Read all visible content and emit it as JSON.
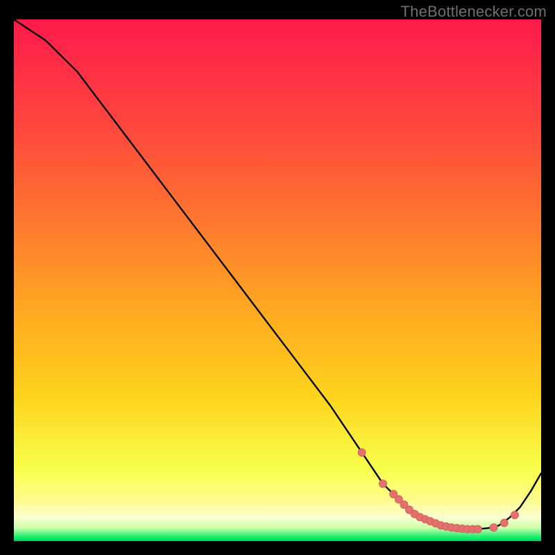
{
  "watermark": "TheBottleneсker.com",
  "colors": {
    "gradient_top": "#ff1a4b",
    "gradient_upper_mid": "#ff7b2e",
    "gradient_mid": "#ffd21c",
    "gradient_lower": "#fffb8a",
    "gradient_pale": "#fbffd2",
    "gradient_bottom": "#00e968",
    "background": "#000000",
    "curve": "#000000",
    "marker_fill": "#e2726e",
    "marker_stroke": "#d85f5b"
  },
  "chart_data": {
    "type": "line",
    "title": "",
    "xlabel": "",
    "ylabel": "",
    "xlim": [
      0,
      100
    ],
    "ylim": [
      0,
      100
    ],
    "series": [
      {
        "name": "bottleneck-curve",
        "x": [
          0,
          6,
          12,
          18,
          24,
          30,
          36,
          42,
          48,
          54,
          60,
          64,
          68,
          70,
          72,
          74,
          76,
          78,
          80,
          82,
          84,
          86,
          88,
          90,
          92,
          94,
          96,
          98,
          100
        ],
        "y": [
          100,
          96,
          90,
          82,
          74,
          66,
          58,
          50,
          42,
          34,
          26,
          20,
          14,
          11,
          9,
          7,
          5.2,
          4.2,
          3.4,
          2.8,
          2.5,
          2.3,
          2.3,
          2.5,
          3.0,
          4.5,
          6.5,
          9.5,
          13
        ]
      }
    ],
    "markers": {
      "name": "valley-markers",
      "x": [
        66,
        70,
        72,
        73,
        74,
        75,
        76,
        77,
        78,
        79,
        80,
        81,
        82,
        83,
        84,
        85,
        86,
        87,
        88,
        91,
        93,
        95
      ],
      "y": [
        17,
        11,
        9,
        8,
        7,
        6,
        5.2,
        4.6,
        4.2,
        3.8,
        3.4,
        3.0,
        2.8,
        2.6,
        2.5,
        2.4,
        2.3,
        2.3,
        2.3,
        2.6,
        3.5,
        5.0
      ]
    }
  }
}
